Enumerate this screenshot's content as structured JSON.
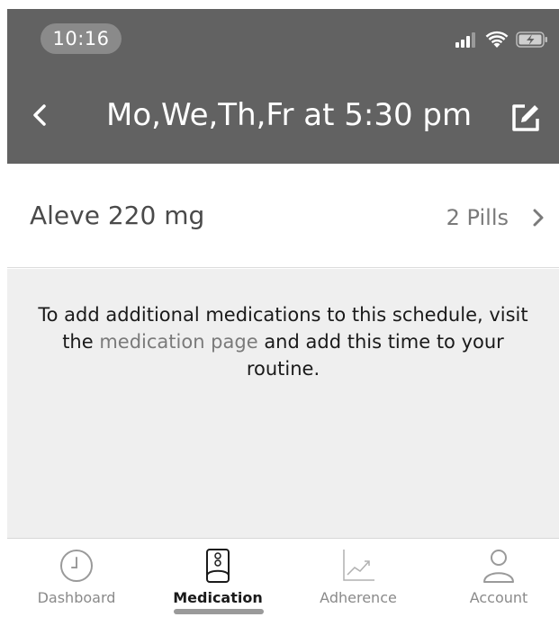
{
  "status_bar": {
    "time": "10:16"
  },
  "nav": {
    "title": "Mo,We,Th,Fr at 5:30 pm",
    "back_icon": "chevron-left-icon",
    "edit_icon": "edit-icon"
  },
  "medication": {
    "name": "Aleve 220 mg",
    "quantity": "2 Pills"
  },
  "info": {
    "text_before": "To add additional medications to this schedule, visit the ",
    "link_text": "medication page",
    "text_after": " and add this time to your routine."
  },
  "tabs": [
    {
      "label": "Dashboard",
      "icon": "clock-icon",
      "active": false
    },
    {
      "label": "Medication",
      "icon": "pill-bottle-icon",
      "active": true
    },
    {
      "label": "Adherence",
      "icon": "chart-trend-icon",
      "active": false
    },
    {
      "label": "Account",
      "icon": "user-icon",
      "active": false
    }
  ],
  "colors": {
    "header_bg": "#626262",
    "info_bg": "#efefef",
    "link": "#7a7a7a"
  }
}
